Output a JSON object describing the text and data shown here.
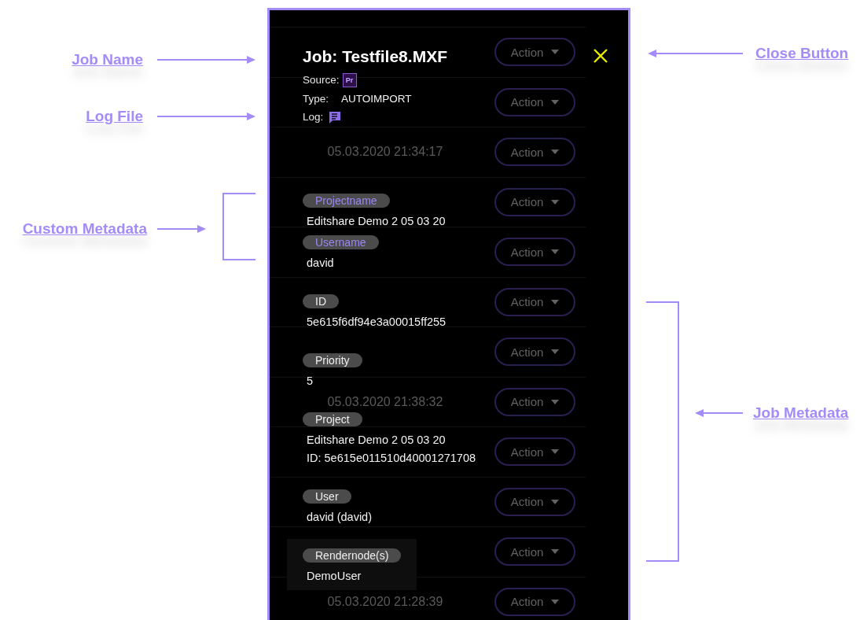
{
  "callouts": [
    {
      "label": "Job Name",
      "kind": "arrow"
    },
    {
      "label": "Log File",
      "kind": "arrow"
    },
    {
      "label": "Custom Metadata",
      "kind": "bracket"
    },
    {
      "label": "Close Button",
      "kind": "arrow"
    },
    {
      "label": "Job Metadata",
      "kind": "bracket"
    }
  ],
  "background_rows": [
    {
      "action": "Action"
    },
    {
      "action": "Action"
    },
    {
      "timestamp": "05.03.2020 21:34:17",
      "action": "Action"
    },
    {
      "action": "Action"
    },
    {
      "action": "Action"
    },
    {
      "action": "Action"
    },
    {
      "action": "Action"
    },
    {
      "timestamp": "05.03.2020 21:38:32",
      "action": "Action"
    },
    {
      "action": "Action"
    },
    {
      "action": "Action"
    },
    {
      "action": "Action"
    },
    {
      "timestamp": "05.03.2020 21:28:39",
      "action": "Action"
    }
  ],
  "job": {
    "title": "Job: Testfile8.MXF",
    "source_label": "Source:",
    "source_icon": "Pr",
    "type_label": "Type:",
    "type": "AUTOIMPORT",
    "log_label": "Log:"
  },
  "custom_metadata": [
    {
      "label": "Projectname",
      "values": [
        "Editshare Demo 2 05 03 20"
      ]
    },
    {
      "label": "Username",
      "values": [
        "david"
      ]
    }
  ],
  "job_metadata": [
    {
      "label": "ID",
      "values": [
        "5e615f6df94e3a00015ff255"
      ],
      "highlighted": false
    },
    {
      "label": "Priority",
      "values": [
        "5"
      ],
      "highlighted": false
    },
    {
      "label": "Project",
      "values": [
        "Editshare Demo 2 05 03 20",
        "ID: 5e615e011510d40001271708"
      ],
      "highlighted": false
    },
    {
      "label": "User",
      "values": [
        "david (david)"
      ],
      "highlighted": false
    },
    {
      "label": "Rendernode(s)",
      "values": [
        "DemoUser"
      ],
      "highlighted": true
    }
  ]
}
